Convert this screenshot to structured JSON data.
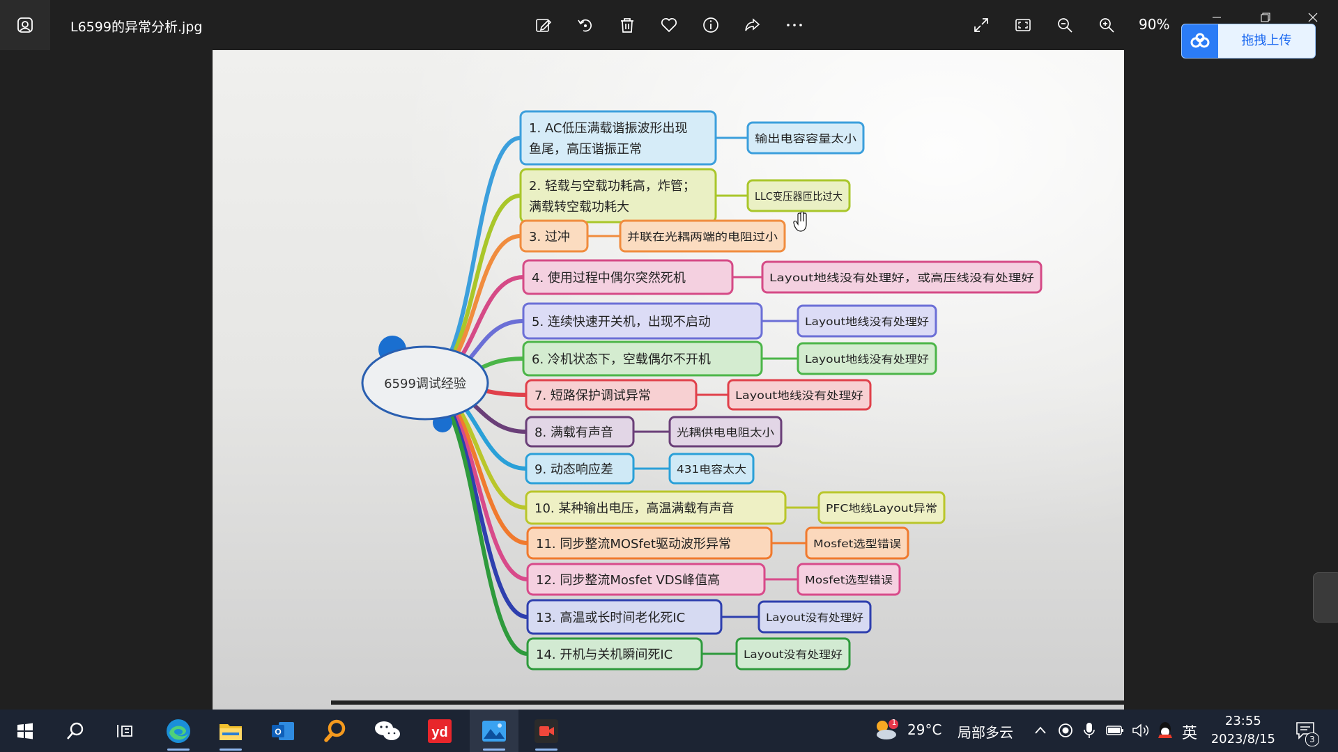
{
  "window": {
    "filename": "L6599的异常分析.jpg",
    "zoom": "90%",
    "upload_label": "拖拽上传"
  },
  "toolbar": {
    "icons": [
      "edit-icon",
      "rotate-icon",
      "delete-icon",
      "favorite-icon",
      "info-icon",
      "share-icon",
      "more-icon"
    ],
    "right_icons": [
      "fullscreen-icon",
      "fit-icon",
      "zoom-out-icon",
      "zoom-in-icon"
    ]
  },
  "mindmap": {
    "root": "6599调试经验",
    "items": [
      {
        "label": "1. AC低压满载谐振波形出现鱼尾，高压谐振正常",
        "cause": "输出电容容量太小",
        "color": "#3c9fdc",
        "fill": "#d6ecf8"
      },
      {
        "label": "2. 轻载与空载功耗高，炸管；满载转空载功耗大",
        "cause": "LLC变压器匝比过大",
        "color": "#a9c62a",
        "fill": "#eaf0c4"
      },
      {
        "label": "3. 过冲",
        "cause": "并联在光耦两端的电阻过小",
        "color": "#f08c3e",
        "fill": "#fbdcc0"
      },
      {
        "label": "4. 使用过程中偶尔突然死机",
        "cause": "Layout地线没有处理好，或高压线没有处理好",
        "color": "#d54a86",
        "fill": "#f4d0e0"
      },
      {
        "label": "5. 连续快速开关机，出现不启动",
        "cause": "Layout地线没有处理好",
        "color": "#6b6fd6",
        "fill": "#dcdcf6"
      },
      {
        "label": "6. 冷机状态下，空载偶尔不开机",
        "cause": "Layout地线没有处理好",
        "color": "#4bb548",
        "fill": "#d4ecd0"
      },
      {
        "label": "7. 短路保护调试异常",
        "cause": "Layout地线没有处理好",
        "color": "#e0404a",
        "fill": "#f7d0d2"
      },
      {
        "label": "8. 满载有声音",
        "cause": "光耦供电电阻太小",
        "color": "#6a3f78",
        "fill": "#e2d6e6"
      },
      {
        "label": "9. 动态响应差",
        "cause": "431电容太大",
        "color": "#2aa0d8",
        "fill": "#cfe9f6"
      },
      {
        "label": "10. 某种输出电压，高温满载有声音",
        "cause": "PFC地线Layout异常",
        "color": "#b9c62a",
        "fill": "#eef0c4"
      },
      {
        "label": "11. 同步整流MOSfet驱动波形异常",
        "cause": "Mosfet选型错误",
        "color": "#f07a2e",
        "fill": "#fbd8bc"
      },
      {
        "label": "12. 同步整流Mosfet VDS峰值高",
        "cause": "Mosfet选型错误",
        "color": "#d84a8a",
        "fill": "#f5d0e0"
      },
      {
        "label": "13. 高温或长时间老化死IC",
        "cause": "Layout没有处理好",
        "color": "#2e3fae",
        "fill": "#d6daf2"
      },
      {
        "label": "14. 开机与关机瞬间死IC",
        "cause": "Layout没有处理好",
        "color": "#2e9a3c",
        "fill": "#d2ead2"
      }
    ]
  },
  "taskbar": {
    "apps": [
      "windows-start-icon",
      "search-icon",
      "task-view-icon",
      "edge-icon",
      "file-explorer-icon",
      "outlook-icon",
      "search-app-icon",
      "wechat-icon",
      "youdao-icon",
      "photos-icon",
      "recorder-icon"
    ],
    "weather_temp": "29°C",
    "weather_desc": "局部多云",
    "weather_badge": "1",
    "ime": "英",
    "time": "23:55",
    "date": "2023/8/15",
    "notifications": "3"
  }
}
